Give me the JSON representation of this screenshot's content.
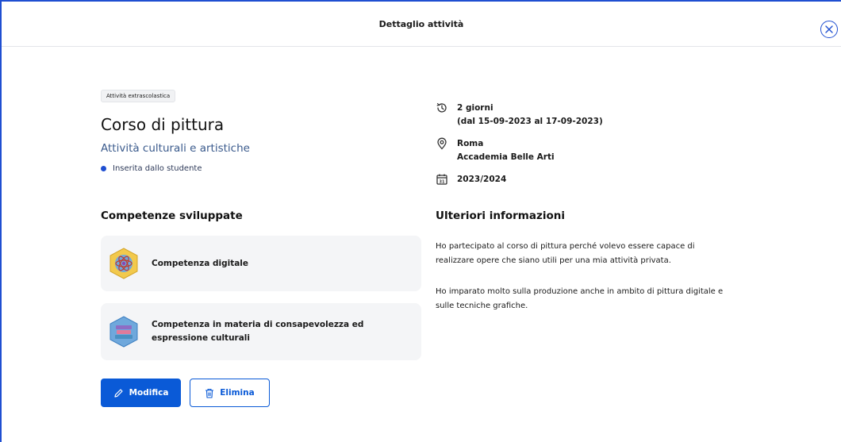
{
  "header": {
    "title": "Dettaglio attività"
  },
  "activity": {
    "tag": "Attività extrascolastica",
    "title": "Corso di pittura",
    "category": "Attività culturali e artistiche",
    "status": "Inserita dallo studente"
  },
  "details": {
    "duration": "2 giorni",
    "date_range": "(dal 15-09-2023 al 17-09-2023)",
    "city": "Roma",
    "place": "Accademia Belle Arti",
    "school_year": "2023/2024",
    "calendar_icon_text": "31"
  },
  "competences": {
    "section_title": "Competenze sviluppate",
    "items": [
      {
        "label": "Competenza digitale",
        "icon": "atom-badge-icon",
        "color": "#f2c94c"
      },
      {
        "label_line1": "Competenza in materia di consapevolezza ed",
        "label_line2": "espressione culturali",
        "icon": "books-badge-icon",
        "color": "#6fa8dc"
      }
    ]
  },
  "extra": {
    "section_title": "Ulteriori informazioni",
    "paragraph1_line1": "Ho partecipato al corso di pittura perché volevo essere capace di",
    "paragraph1_line2": "realizzare opere che siano utili per una mia attività privata.",
    "paragraph2_line1": "Ho imparato molto sulla produzione anche in ambito di pittura digitale e",
    "paragraph2_line2": "sulle tecniche grafiche."
  },
  "actions": {
    "edit_label": "Modifica",
    "delete_label": "Elimina"
  },
  "colors": {
    "primary": "#0a5ad7",
    "accent_border": "#1f4fd1",
    "card_bg": "#f4f5f7"
  }
}
